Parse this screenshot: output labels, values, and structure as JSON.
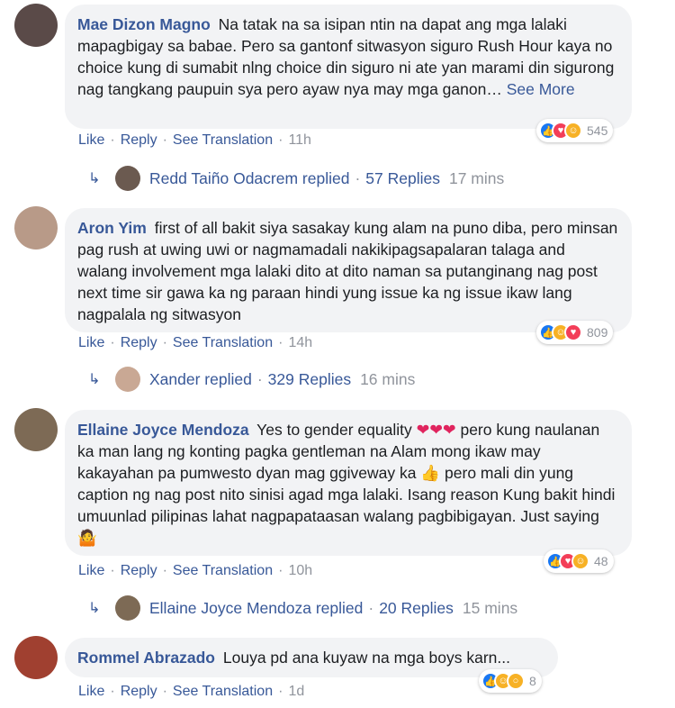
{
  "comments": [
    {
      "name": "Mae Dizon Magno",
      "text": "Na tatak na sa isipan ntin na dapat ang mga lalaki mapagbigay sa babae. Pero sa gantonf sitwasyon siguro Rush Hour kaya no choice kung di sumabit nlng choice din siguro ni ate yan marami din sigurong nag tangkang paupuin sya pero ayaw nya may mga ganon…",
      "see_more": "See More",
      "like": "Like",
      "reply": "Reply",
      "translate": "See Translation",
      "time": "11h",
      "reaction_count": "545",
      "reactions": [
        "like",
        "love",
        "haha"
      ],
      "replies": {
        "arrow": "↳",
        "author": "Redd Taiño Odacrem replied",
        "count": "57 Replies",
        "time": "17 mins"
      }
    },
    {
      "name": "Aron Yim",
      "text": "first of all bakit siya sasakay kung alam na puno diba, pero minsan pag rush at uwing uwi or nagmamadali nakikipagsapalaran talaga and walang involvement mga lalaki dito at dito naman sa putanginang nag post next time sir gawa ka ng paraan hindi yung issue ka ng issue ikaw lang nagpalala ng sitwasyon",
      "like": "Like",
      "reply": "Reply",
      "translate": "See Translation",
      "time": "14h",
      "reaction_count": "809",
      "reactions": [
        "like",
        "haha",
        "love"
      ],
      "replies": {
        "arrow": "↳",
        "author": "Xander replied",
        "count": "329 Replies",
        "time": "16 mins"
      }
    },
    {
      "name": "Ellaine Joyce Mendoza",
      "text_a": "Yes to gender equality",
      "hearts": "❤❤❤",
      "text_b": "pero kung naulanan ka man lang ng konting pagka gentleman na Alam mong ikaw may kakayahan pa pumwesto dyan mag ggiveway ka",
      "thumbs": "👍",
      "text_c": "pero mali din yung caption ng nag post nito sinisi agad mga lalaki. Isang reason Kung bakit hindi umuunlad pilipinas lahat nagpapataasan walang pagbibigayan. Just saying",
      "shrug": "🤷",
      "like": "Like",
      "reply": "Reply",
      "translate": "See Translation",
      "time": "10h",
      "reaction_count": "48",
      "reactions": [
        "like",
        "love",
        "haha"
      ],
      "replies": {
        "arrow": "↳",
        "author": "Ellaine Joyce Mendoza replied",
        "count": "20 Replies",
        "time": "15 mins"
      }
    },
    {
      "name": "Rommel Abrazado",
      "text": "Louya pd ana kuyaw na mga boys karn...",
      "like": "Like",
      "reply": "Reply",
      "translate": "See Translation",
      "time": "1d",
      "reaction_count": "8",
      "reactions": [
        "like",
        "haha",
        "wow"
      ]
    }
  ],
  "separator": "·",
  "colors": {
    "link": "#385898",
    "muted": "#90949c",
    "bubble": "#f2f3f5",
    "like": "#1877f2",
    "love": "#f33e58",
    "haha": "#f7b125"
  }
}
